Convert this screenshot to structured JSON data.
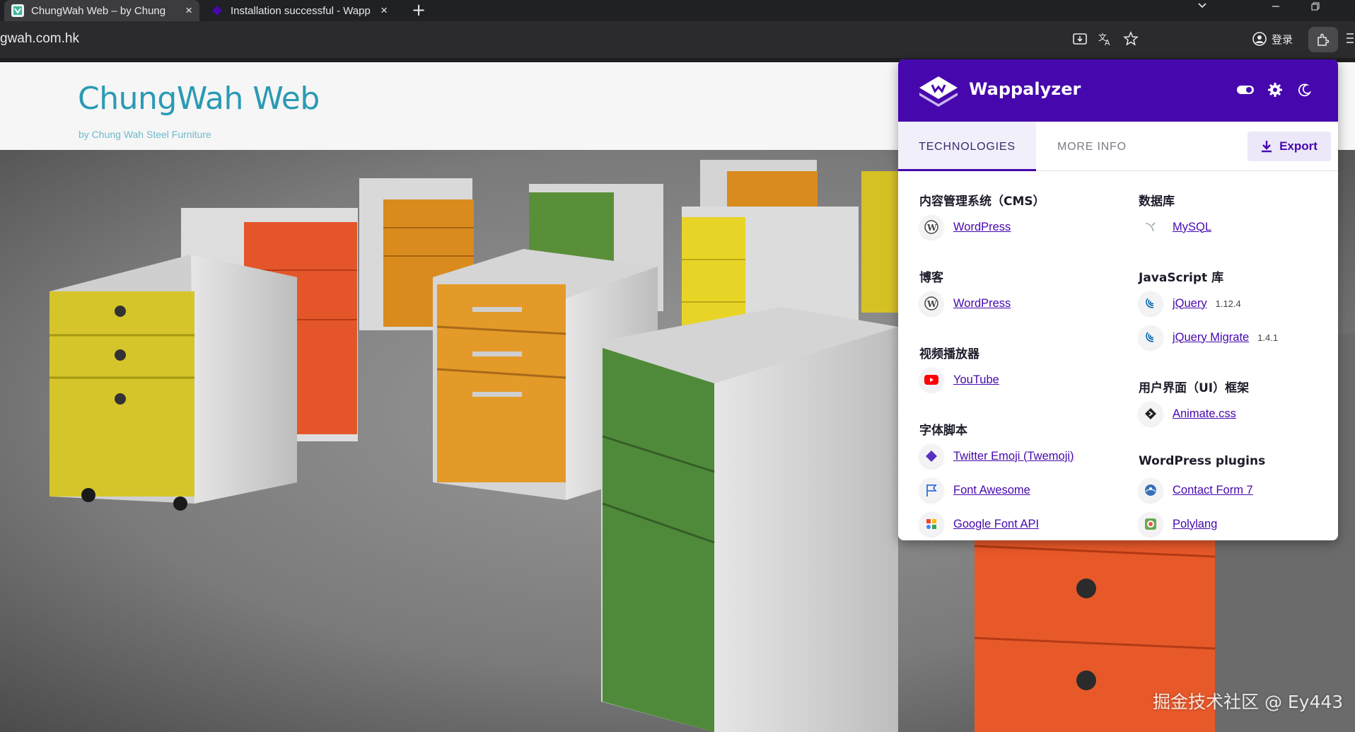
{
  "browser": {
    "tabs": [
      {
        "title": "ChungWah Web – by Chung",
        "close": "×"
      },
      {
        "title": "Installation successful - Wapp",
        "close": "×"
      }
    ],
    "new_tab": "+",
    "url": "gwah.com.hk",
    "login_label": "登录"
  },
  "site": {
    "title": "ChungWah Web",
    "tagline": "by Chung Wah Steel Furniture"
  },
  "wappalyzer": {
    "brand": "Wappalyzer",
    "tabs": [
      "TECHNOLOGIES",
      "MORE INFO"
    ],
    "export_label": "Export",
    "left_column": [
      {
        "category": "内容管理系统（CMS）",
        "items": [
          {
            "name": "WordPress",
            "icon": "wordpress-icon",
            "version": ""
          }
        ]
      },
      {
        "category": "博客",
        "items": [
          {
            "name": "WordPress",
            "icon": "wordpress-icon",
            "version": ""
          }
        ]
      },
      {
        "category": "视频播放器",
        "items": [
          {
            "name": "YouTube",
            "icon": "youtube-icon",
            "version": ""
          }
        ]
      },
      {
        "category": "字体脚本",
        "items": [
          {
            "name": "Twitter Emoji (Twemoji)",
            "icon": "twemoji-icon",
            "version": ""
          },
          {
            "name": "Font Awesome",
            "icon": "font-awesome-icon",
            "version": ""
          },
          {
            "name": "Google Font API",
            "icon": "google-font-icon",
            "version": ""
          }
        ]
      }
    ],
    "right_column": [
      {
        "category": "数据库",
        "items": [
          {
            "name": "MySQL",
            "icon": "mysql-icon",
            "version": ""
          }
        ]
      },
      {
        "category": "JavaScript 库",
        "items": [
          {
            "name": "jQuery",
            "icon": "jquery-icon",
            "version": "1.12.4"
          },
          {
            "name": "jQuery Migrate",
            "icon": "jquery-icon",
            "version": "1.4.1"
          }
        ]
      },
      {
        "category": "用户界面（UI）框架",
        "items": [
          {
            "name": "Animate.css",
            "icon": "animate-css-icon",
            "version": ""
          }
        ]
      },
      {
        "category": "WordPress plugins",
        "items": [
          {
            "name": "Contact Form 7",
            "icon": "contact-form-icon",
            "version": ""
          },
          {
            "name": "Polylang",
            "icon": "polylang-icon",
            "version": ""
          }
        ]
      }
    ]
  },
  "watermark": "掘金技术社区 @ Ey443",
  "colors": {
    "wappalyzer_purple": "#4608ad",
    "site_title": "#2a9ab4"
  }
}
